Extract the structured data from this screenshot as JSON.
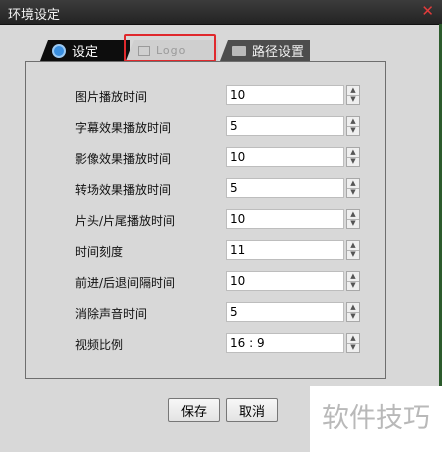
{
  "window": {
    "title": "环境设定"
  },
  "tabs": [
    {
      "label": "设定",
      "icon": "gear-icon",
      "active": true
    },
    {
      "label": "Logo",
      "icon": "logo-icon",
      "active": false
    },
    {
      "label": "路径设置",
      "icon": "folder-icon",
      "active": false
    }
  ],
  "rows": [
    {
      "label": "图片播放时间",
      "value": "10"
    },
    {
      "label": "字幕效果播放时间",
      "value": "5"
    },
    {
      "label": "影像效果播放时间",
      "value": "10"
    },
    {
      "label": "转场效果播放时间",
      "value": "5"
    },
    {
      "label": "片头/片尾播放时间",
      "value": "10"
    },
    {
      "label": "时间刻度",
      "value": "11"
    },
    {
      "label": "前进/后退间隔时间",
      "value": "10"
    },
    {
      "label": "消除声音时间",
      "value": "5"
    },
    {
      "label": "视频比例",
      "value": "16 : 9"
    }
  ],
  "buttons": {
    "save_label": "保存",
    "cancel_label": "取消"
  },
  "watermark": {
    "text": "软件技巧"
  },
  "colors": {
    "titlebar": "#2d2d2d",
    "highlight": "#e0292d",
    "tab_active": "#0d0d0d"
  }
}
